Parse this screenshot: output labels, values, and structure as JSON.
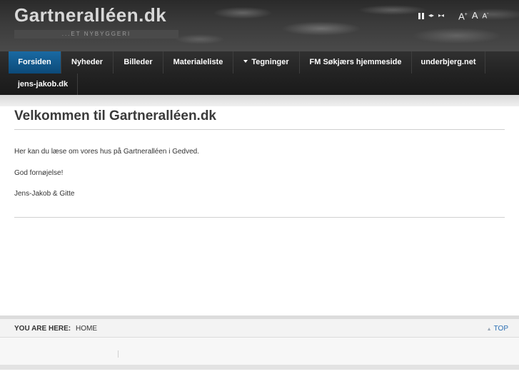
{
  "header": {
    "site_title": "Gartneralléen.dk",
    "site_slogan": "...ET NYBYGGERI",
    "tools": {
      "pause_icon": "pause-icon",
      "prev_icon": "prev-icon",
      "next_icon": "next-icon",
      "font_larger_label": "A",
      "font_larger_sup": "+",
      "font_reset_label": "A",
      "font_smaller_label": "A",
      "font_smaller_sup": "-"
    }
  },
  "nav": {
    "items": [
      {
        "label": "Forsiden"
      },
      {
        "label": "Nyheder"
      },
      {
        "label": "Billeder"
      },
      {
        "label": "Materialeliste"
      },
      {
        "label": "Tegninger"
      },
      {
        "label": "FM Søkjærs hjemmeside"
      },
      {
        "label": "underbjerg.net"
      },
      {
        "label": "jens-jakob.dk"
      }
    ],
    "active_index": 0
  },
  "content": {
    "title": "Velkommen til Gartneralléen.dk",
    "paragraphs": [
      "Her kan du læse om vores hus på Gartneralléen i Gedved.",
      "God fornøjelse!",
      "Jens-Jakob & Gitte"
    ]
  },
  "breadcrumb": {
    "label": "YOU ARE HERE:",
    "home": "HOME",
    "top_link": "TOP",
    "top_icon": "arrow-up-icon"
  },
  "colors": {
    "active_nav": "#0c4a79",
    "link": "#2b6fb3",
    "header_bg": "#3b3b3b"
  }
}
